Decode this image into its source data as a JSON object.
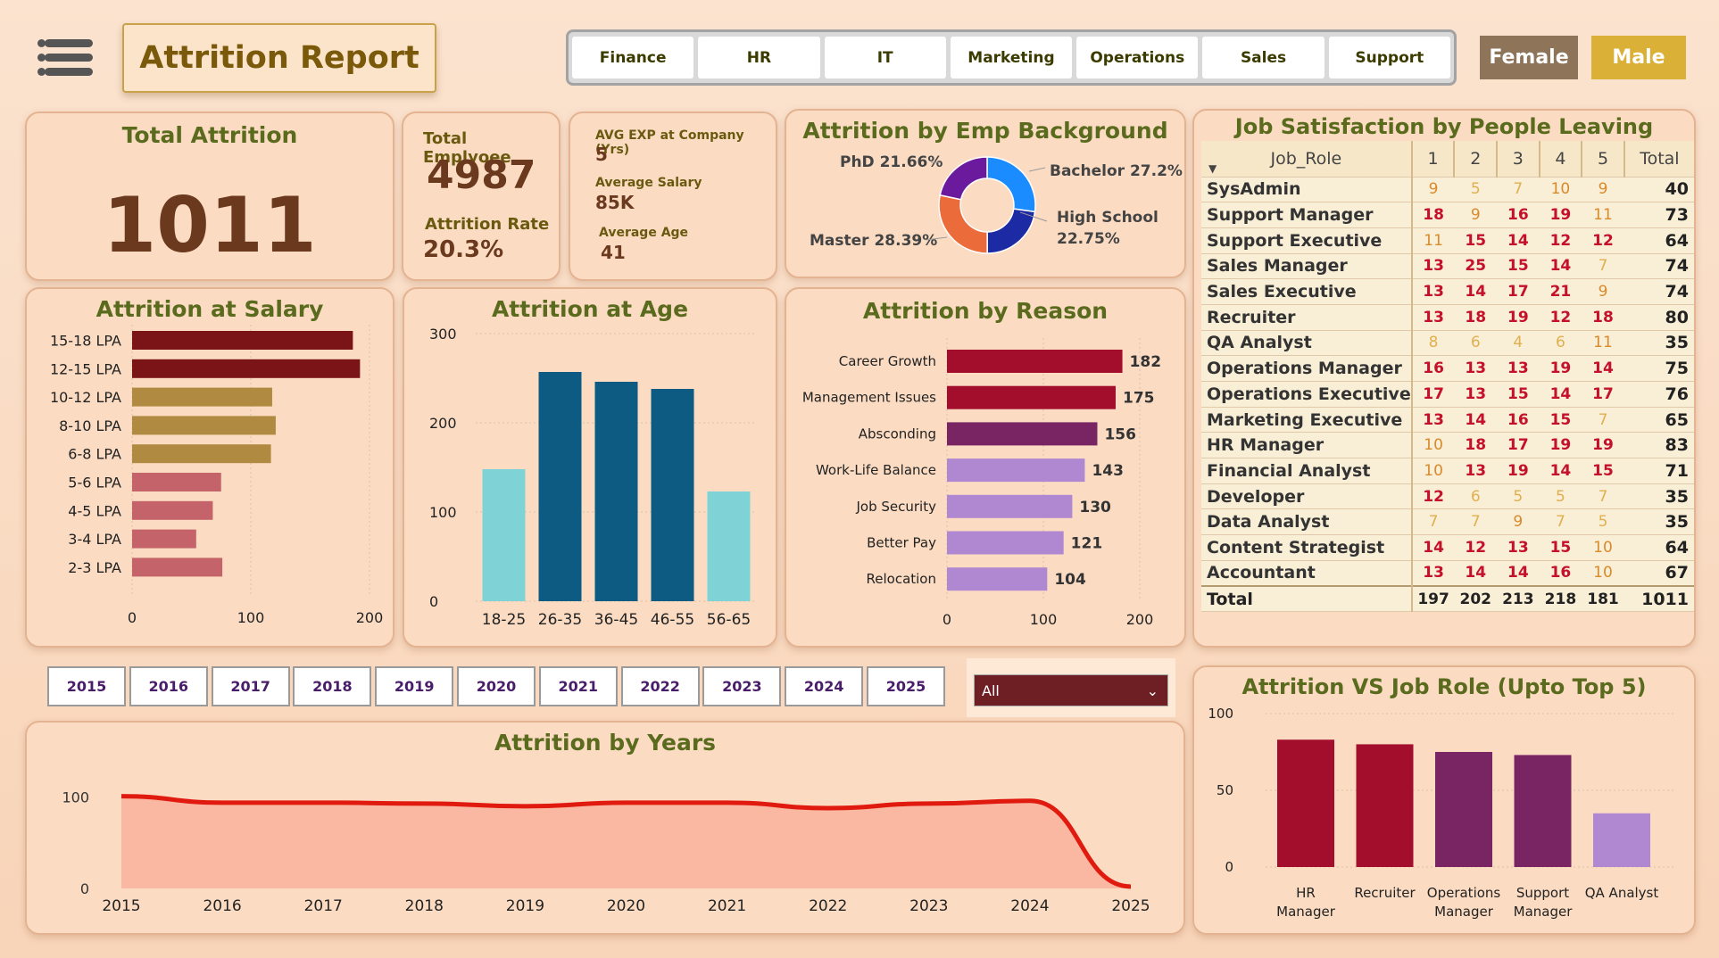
{
  "header": {
    "title": "Attrition Report",
    "departments": [
      "Finance",
      "HR",
      "IT",
      "Marketing",
      "Operations",
      "Sales",
      "Support"
    ],
    "gender": {
      "female": "Female",
      "male": "Male"
    }
  },
  "kpis": {
    "total_attrition_label": "Total Attrition",
    "total_attrition": "1011",
    "total_employee_label": "Total Emplyoee",
    "total_employee": "4987",
    "attrition_rate_label": "Attrition Rate",
    "attrition_rate": "20.3%",
    "avg_exp_label": "AVG EXP at Company (Yrs)",
    "avg_exp": "5",
    "avg_salary_label": "Average Salary",
    "avg_salary": "85K",
    "avg_age_label": "Average Age",
    "avg_age": "41"
  },
  "years": [
    "2015",
    "2016",
    "2017",
    "2018",
    "2019",
    "2020",
    "2021",
    "2022",
    "2023",
    "2024",
    "2025"
  ],
  "filter": {
    "selected": "All"
  },
  "job_satisfaction": {
    "title": "Job Satisfaction by People Leaving",
    "columns": [
      "Job_Role",
      "1",
      "2",
      "3",
      "4",
      "5",
      "Total"
    ],
    "rows": [
      {
        "role": "SysAdmin",
        "v": [
          "9",
          "5",
          "7",
          "10",
          "9"
        ],
        "total": "40"
      },
      {
        "role": "Support Manager",
        "v": [
          "18",
          "9",
          "16",
          "19",
          "11"
        ],
        "total": "73"
      },
      {
        "role": "Support Executive",
        "v": [
          "11",
          "15",
          "14",
          "12",
          "12"
        ],
        "total": "64"
      },
      {
        "role": "Sales Manager",
        "v": [
          "13",
          "25",
          "15",
          "14",
          "7"
        ],
        "total": "74"
      },
      {
        "role": "Sales Executive",
        "v": [
          "13",
          "14",
          "17",
          "21",
          "9"
        ],
        "total": "74"
      },
      {
        "role": "Recruiter",
        "v": [
          "13",
          "18",
          "19",
          "12",
          "18"
        ],
        "total": "80"
      },
      {
        "role": "QA Analyst",
        "v": [
          "8",
          "6",
          "4",
          "6",
          "11"
        ],
        "total": "35"
      },
      {
        "role": "Operations Manager",
        "v": [
          "16",
          "13",
          "13",
          "19",
          "14"
        ],
        "total": "75"
      },
      {
        "role": "Operations Executive",
        "v": [
          "17",
          "13",
          "15",
          "14",
          "17"
        ],
        "total": "76"
      },
      {
        "role": "Marketing Executive",
        "v": [
          "13",
          "14",
          "16",
          "15",
          "7"
        ],
        "total": "65"
      },
      {
        "role": "HR Manager",
        "v": [
          "10",
          "18",
          "17",
          "19",
          "19"
        ],
        "total": "83"
      },
      {
        "role": "Financial Analyst",
        "v": [
          "10",
          "13",
          "19",
          "14",
          "15"
        ],
        "total": "71"
      },
      {
        "role": "Developer",
        "v": [
          "12",
          "6",
          "5",
          "5",
          "7"
        ],
        "total": "35"
      },
      {
        "role": "Data Analyst",
        "v": [
          "7",
          "7",
          "9",
          "7",
          "5"
        ],
        "total": "35"
      },
      {
        "role": "Content Strategist",
        "v": [
          "14",
          "12",
          "13",
          "15",
          "10"
        ],
        "total": "64"
      },
      {
        "role": "Accountant",
        "v": [
          "13",
          "14",
          "14",
          "16",
          "10"
        ],
        "total": "67"
      }
    ],
    "totals": {
      "label": "Total",
      "v": [
        "197",
        "202",
        "213",
        "218",
        "181"
      ],
      "total": "1011"
    }
  },
  "colors": {
    "salary_dark": "#7b1416",
    "salary_mid": "#b08a41",
    "salary_light": "#c4646a",
    "age_light": "#7fd3d6",
    "age_dark": "#0d5b82",
    "reason_red": "#a30e2d",
    "reason_purple": "#7a2563",
    "reason_light": "#b088d1",
    "bg_blue": "#1a8cff",
    "bg_navy": "#1c2aa3",
    "bg_orange": "#eb6b3a",
    "bg_purple": "#6b1a9e",
    "years_line": "#e01a0f",
    "years_fill": "#f9b39d"
  },
  "chart_data": [
    {
      "id": "background",
      "type": "pie",
      "title": "Attrition by Emp Background",
      "categories": [
        "Bachelor",
        "High School",
        "Master",
        "PhD"
      ],
      "values": [
        27.2,
        22.75,
        28.39,
        21.66
      ],
      "labels": [
        "Bachelor 27.2%",
        "High School",
        "22.75%",
        "Master 28.39%",
        "PhD 21.66%"
      ]
    },
    {
      "id": "salary",
      "type": "bar",
      "title": "Attrition at Salary",
      "categories": [
        "15-18 LPA",
        "12-15 LPA",
        "10-12 LPA",
        "8-10 LPA",
        "6-8 LPA",
        "5-6 LPA",
        "4-5 LPA",
        "3-4 LPA",
        "2-3 LPA"
      ],
      "values": [
        186,
        192,
        118,
        121,
        117,
        75,
        68,
        54,
        76
      ],
      "xlim": [
        0,
        200
      ],
      "xticks": [
        "0",
        "100",
        "200"
      ]
    },
    {
      "id": "age",
      "type": "bar",
      "title": "Attrition at Age",
      "categories": [
        "18-25",
        "26-35",
        "36-45",
        "46-55",
        "56-65"
      ],
      "values": [
        148,
        257,
        246,
        238,
        123
      ],
      "ylim": [
        0,
        300
      ],
      "yticks": [
        "300",
        "200",
        "100",
        "0"
      ]
    },
    {
      "id": "reason",
      "type": "bar",
      "title": "Attrition by Reason",
      "categories": [
        "Career Growth",
        "Management Issues",
        "Absconding",
        "Work-Life Balance",
        "Job Security",
        "Better Pay",
        "Relocation"
      ],
      "values": [
        182,
        175,
        156,
        143,
        130,
        121,
        104
      ],
      "data_labels": [
        "182",
        "175",
        "156",
        "143",
        "130",
        "121",
        "104"
      ],
      "xlim": [
        0,
        200
      ],
      "xticks": [
        "0",
        "100",
        "200"
      ]
    },
    {
      "id": "years",
      "type": "area",
      "title": "Attrition by Years",
      "x": [
        "2015",
        "2016",
        "2017",
        "2018",
        "2019",
        "2020",
        "2021",
        "2022",
        "2023",
        "2024",
        "2025"
      ],
      "values": [
        101,
        94,
        94,
        93,
        90,
        94,
        94,
        88,
        93,
        96,
        2
      ],
      "ylim": [
        0,
        130
      ],
      "yticks": [
        "100",
        "0"
      ]
    },
    {
      "id": "jobrole",
      "type": "bar",
      "title": "Attrition VS Job Role (Upto Top 5)",
      "categories": [
        "HR Manager",
        "Recruiter",
        "Operations Manager",
        "Support Manager",
        "QA Analyst"
      ],
      "category_lines": [
        [
          "HR",
          "Manager"
        ],
        [
          "Recruiter"
        ],
        [
          "Operations",
          "Manager"
        ],
        [
          "Support",
          "Manager"
        ],
        [
          "QA Analyst"
        ]
      ],
      "values": [
        83,
        80,
        75,
        73,
        35
      ],
      "ylim": [
        0,
        100
      ],
      "yticks": [
        "100",
        "50",
        "0"
      ]
    }
  ]
}
